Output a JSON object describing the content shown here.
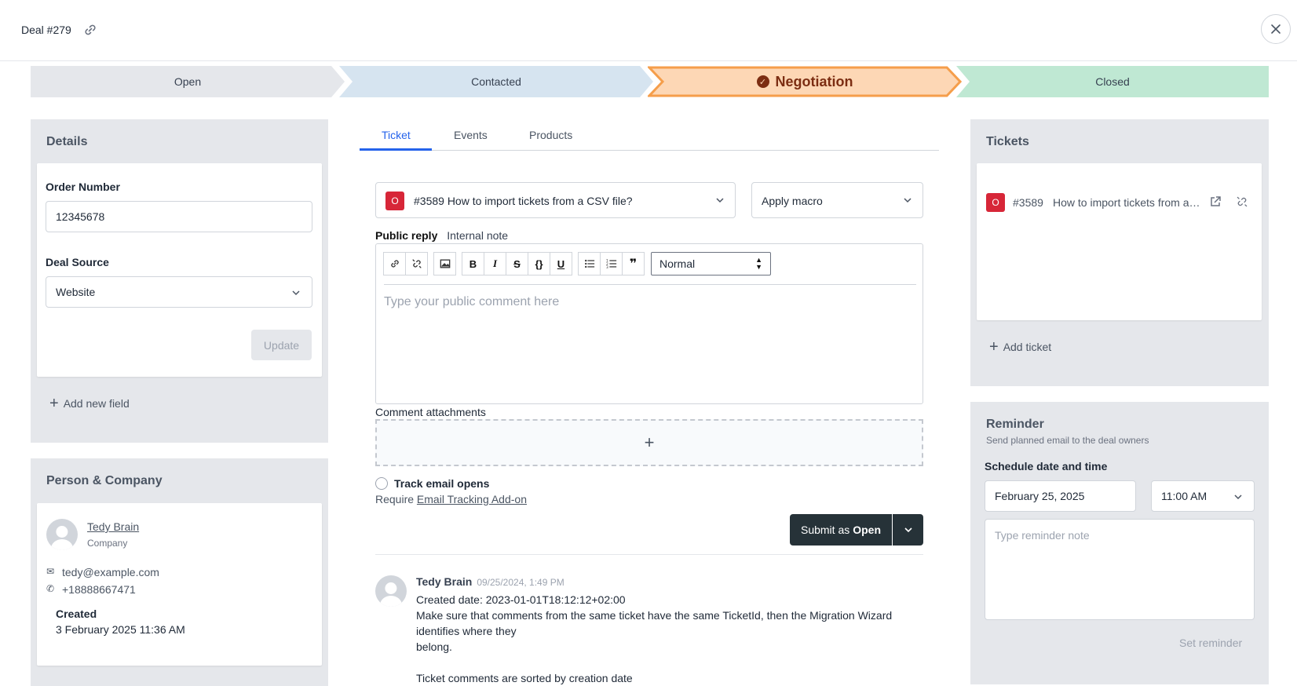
{
  "header": {
    "title": "Deal #279"
  },
  "pipeline": {
    "stages": [
      {
        "label": "Open",
        "color": "#e5e7eb"
      },
      {
        "label": "Contacted",
        "color": "#d6e4f0"
      },
      {
        "label": "Negotiation",
        "color": "#fdd7b5",
        "border": "#f59e4b",
        "active": true
      },
      {
        "label": "Closed",
        "color": "#bfe8d3"
      }
    ]
  },
  "details": {
    "title": "Details",
    "order_number_label": "Order Number",
    "order_number_value": "12345678",
    "deal_source_label": "Deal Source",
    "deal_source_value": "Website",
    "update_label": "Update",
    "add_field_label": "Add new field"
  },
  "person": {
    "title": "Person & Company",
    "name": "Tedy Brain",
    "company": "Company",
    "email": "tedy@example.com",
    "phone": "+18888667471",
    "created_label": "Created",
    "created_value": "3 February 2025 11:36 AM"
  },
  "tabs": {
    "ticket": "Ticket",
    "events": "Events",
    "products": "Products"
  },
  "ticket_select": {
    "badge": "O",
    "value": "#3589 How to import tickets from a CSV file?"
  },
  "macro": {
    "value": "Apply macro"
  },
  "reply": {
    "public_label": "Public reply",
    "internal_label": "Internal note",
    "format_value": "Normal",
    "placeholder": "Type your public comment here",
    "attachments_label": "Comment attachments",
    "track_label": "Track email opens",
    "require_prefix": "Require",
    "require_link": "Email Tracking Add-on",
    "submit_prefix": "Submit as",
    "submit_status": "Open"
  },
  "comment": {
    "author": "Tedy Brain",
    "time": "09/25/2024, 1:49 PM",
    "line1": "Created date: 2023-01-01T18:12:12+02:00",
    "line2": "Make sure that comments from the same ticket have the same TicketId, then the Migration Wizard",
    "line3": "identifies where they",
    "line4": "belong.",
    "line5": "Ticket comments are sorted by creation date"
  },
  "tickets": {
    "title": "Tickets",
    "badge": "O",
    "number": "#3589",
    "subject": "How to import tickets from a CSV file?",
    "add_label": "Add ticket"
  },
  "reminder": {
    "title": "Reminder",
    "subtitle": "Send planned email to the deal owners",
    "schedule_label": "Schedule date and time",
    "date_value": "February 25, 2025",
    "time_value": "11:00 AM",
    "note_placeholder": "Type reminder note",
    "set_label": "Set reminder"
  }
}
